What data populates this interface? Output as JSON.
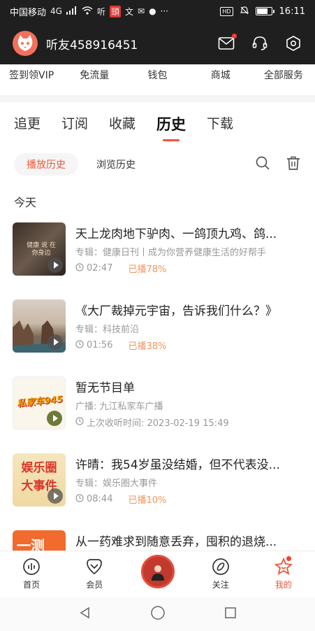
{
  "status": {
    "carrier": "中国移动",
    "net": "4G",
    "time": "16:11",
    "battery_level": 0.8
  },
  "header": {
    "username": "听友458916451"
  },
  "quick_links": [
    "签到领VIP",
    "免流量",
    "钱包",
    "商城",
    "全部服务"
  ],
  "tabs": [
    "追更",
    "订阅",
    "收藏",
    "历史",
    "下载"
  ],
  "active_tab": "历史",
  "subtabs": {
    "play_history": "播放历史",
    "browse_history": "浏览历史"
  },
  "section_title": "今天",
  "items": [
    {
      "title": "天上龙肉地下驴肉、一鸽顶九鸡、鸽...",
      "subtitle": "专辑：健康日刊丨成为你营养健康生活的好帮手",
      "duration": "02:47",
      "played": "已播78%",
      "thumb_text": "健康 说 在你身边"
    },
    {
      "title": "《大厂裁掉元宇宙，告诉我们什么？》",
      "subtitle": "专辑：科技前沿",
      "duration": "01:56",
      "played": "已播38%"
    },
    {
      "title": "暂无节目单",
      "subtitle": "广播: 九江私家车广播",
      "duration": "上次收听时间: 2023-02-19 15:49",
      "played": "",
      "thumb_text": "私家车945"
    },
    {
      "title": "许晴：我54岁虽没结婚，但不代表没...",
      "subtitle": "专辑：娱乐圈大事件",
      "duration": "08:44",
      "played": "已播10%",
      "thumb_text": "娱乐圈 大事件"
    },
    {
      "title": "从一药难求到随意丢弃，囤积的退烧...",
      "subtitle": "",
      "duration": "",
      "played": "",
      "thumb_text": "一测"
    }
  ],
  "bottom_nav": {
    "home": "首页",
    "vip": "会员",
    "follow": "关注",
    "mine": "我的"
  },
  "colors": {
    "accent": "#f0553a",
    "played": "#f2955f",
    "dark_header": "#1f1f1f"
  }
}
